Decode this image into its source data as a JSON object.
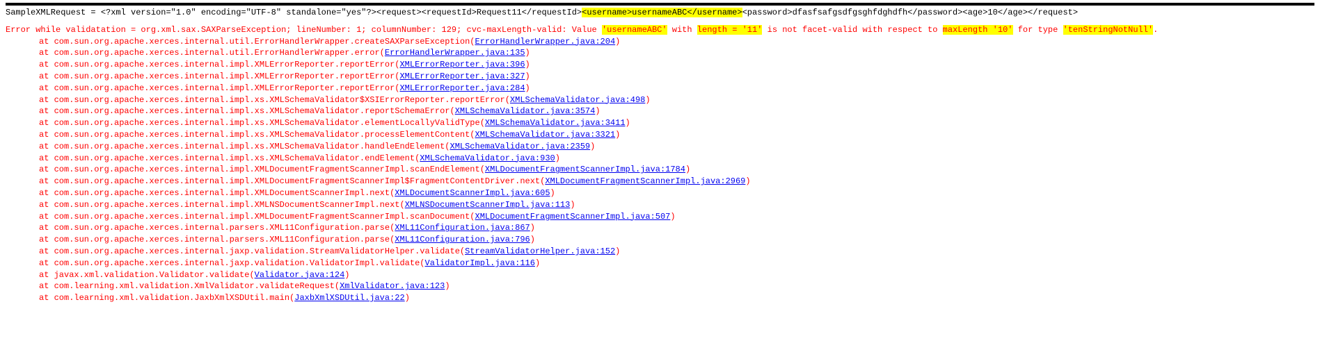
{
  "xml_request": {
    "prefix": "SampleXMLRequest = <?xml version=\"1.0\" encoding=\"UTF-8\" standalone=\"yes\"?><request><requestId>Request11</requestId>",
    "highlighted_username": "<username>usernameABC</username>",
    "suffix": "<password>dfasfsafgsdfgsghfdghdfh</password><age>10</age></request>"
  },
  "error_line": {
    "p1": "Error while validatation   = org.xml.sax.SAXParseException; lineNumber: 1; columnNumber: 129;",
    "p2": " cvc-maxLength-valid: Value ",
    "h1": "'usernameABC'",
    "p3": " with ",
    "h2": "length = '11'",
    "p4": " is not facet-valid with respect to ",
    "h3": "maxLength '10'",
    "p5": " for type ",
    "h4": "'tenStringNotNull'",
    "p6": "."
  },
  "stack": [
    {
      "prefix": "at com.sun.org.apache.xerces.internal.util.ErrorHandlerWrapper.createSAXParseException(",
      "link": "ErrorHandlerWrapper.java:204",
      "suffix": ")"
    },
    {
      "prefix": "at com.sun.org.apache.xerces.internal.util.ErrorHandlerWrapper.error(",
      "link": "ErrorHandlerWrapper.java:135",
      "suffix": ")"
    },
    {
      "prefix": "at com.sun.org.apache.xerces.internal.impl.XMLErrorReporter.reportError(",
      "link": "XMLErrorReporter.java:396",
      "suffix": ")"
    },
    {
      "prefix": "at com.sun.org.apache.xerces.internal.impl.XMLErrorReporter.reportError(",
      "link": "XMLErrorReporter.java:327",
      "suffix": ")"
    },
    {
      "prefix": "at com.sun.org.apache.xerces.internal.impl.XMLErrorReporter.reportError(",
      "link": "XMLErrorReporter.java:284",
      "suffix": ")"
    },
    {
      "prefix": "at com.sun.org.apache.xerces.internal.impl.xs.XMLSchemaValidator$XSIErrorReporter.reportError(",
      "link": "XMLSchemaValidator.java:498",
      "suffix": ")"
    },
    {
      "prefix": "at com.sun.org.apache.xerces.internal.impl.xs.XMLSchemaValidator.reportSchemaError(",
      "link": "XMLSchemaValidator.java:3574",
      "suffix": ")"
    },
    {
      "prefix": "at com.sun.org.apache.xerces.internal.impl.xs.XMLSchemaValidator.elementLocallyValidType(",
      "link": "XMLSchemaValidator.java:3411",
      "suffix": ")"
    },
    {
      "prefix": "at com.sun.org.apache.xerces.internal.impl.xs.XMLSchemaValidator.processElementContent(",
      "link": "XMLSchemaValidator.java:3321",
      "suffix": ")"
    },
    {
      "prefix": "at com.sun.org.apache.xerces.internal.impl.xs.XMLSchemaValidator.handleEndElement(",
      "link": "XMLSchemaValidator.java:2359",
      "suffix": ")"
    },
    {
      "prefix": "at com.sun.org.apache.xerces.internal.impl.xs.XMLSchemaValidator.endElement(",
      "link": "XMLSchemaValidator.java:930",
      "suffix": ")"
    },
    {
      "prefix": "at com.sun.org.apache.xerces.internal.impl.XMLDocumentFragmentScannerImpl.scanEndElement(",
      "link": "XMLDocumentFragmentScannerImpl.java:1784",
      "suffix": ")"
    },
    {
      "prefix": "at com.sun.org.apache.xerces.internal.impl.XMLDocumentFragmentScannerImpl$FragmentContentDriver.next(",
      "link": "XMLDocumentFragmentScannerImpl.java:2969",
      "suffix": ")"
    },
    {
      "prefix": "at com.sun.org.apache.xerces.internal.impl.XMLDocumentScannerImpl.next(",
      "link": "XMLDocumentScannerImpl.java:605",
      "suffix": ")"
    },
    {
      "prefix": "at com.sun.org.apache.xerces.internal.impl.XMLNSDocumentScannerImpl.next(",
      "link": "XMLNSDocumentScannerImpl.java:113",
      "suffix": ")"
    },
    {
      "prefix": "at com.sun.org.apache.xerces.internal.impl.XMLDocumentFragmentScannerImpl.scanDocument(",
      "link": "XMLDocumentFragmentScannerImpl.java:507",
      "suffix": ")"
    },
    {
      "prefix": "at com.sun.org.apache.xerces.internal.parsers.XML11Configuration.parse(",
      "link": "XML11Configuration.java:867",
      "suffix": ")"
    },
    {
      "prefix": "at com.sun.org.apache.xerces.internal.parsers.XML11Configuration.parse(",
      "link": "XML11Configuration.java:796",
      "suffix": ")"
    },
    {
      "prefix": "at com.sun.org.apache.xerces.internal.jaxp.validation.StreamValidatorHelper.validate(",
      "link": "StreamValidatorHelper.java:152",
      "suffix": ")"
    },
    {
      "prefix": "at com.sun.org.apache.xerces.internal.jaxp.validation.ValidatorImpl.validate(",
      "link": "ValidatorImpl.java:116",
      "suffix": ")"
    },
    {
      "prefix": "at javax.xml.validation.Validator.validate(",
      "link": "Validator.java:124",
      "suffix": ")"
    },
    {
      "prefix": "at com.learning.xml.validation.XmlValidator.validateRequest(",
      "link": "XmlValidator.java:123",
      "suffix": ")"
    },
    {
      "prefix": "at com.learning.xml.validation.JaxbXmlXSDUtil.main(",
      "link": "JaxbXmlXSDUtil.java:22",
      "suffix": ")"
    }
  ]
}
